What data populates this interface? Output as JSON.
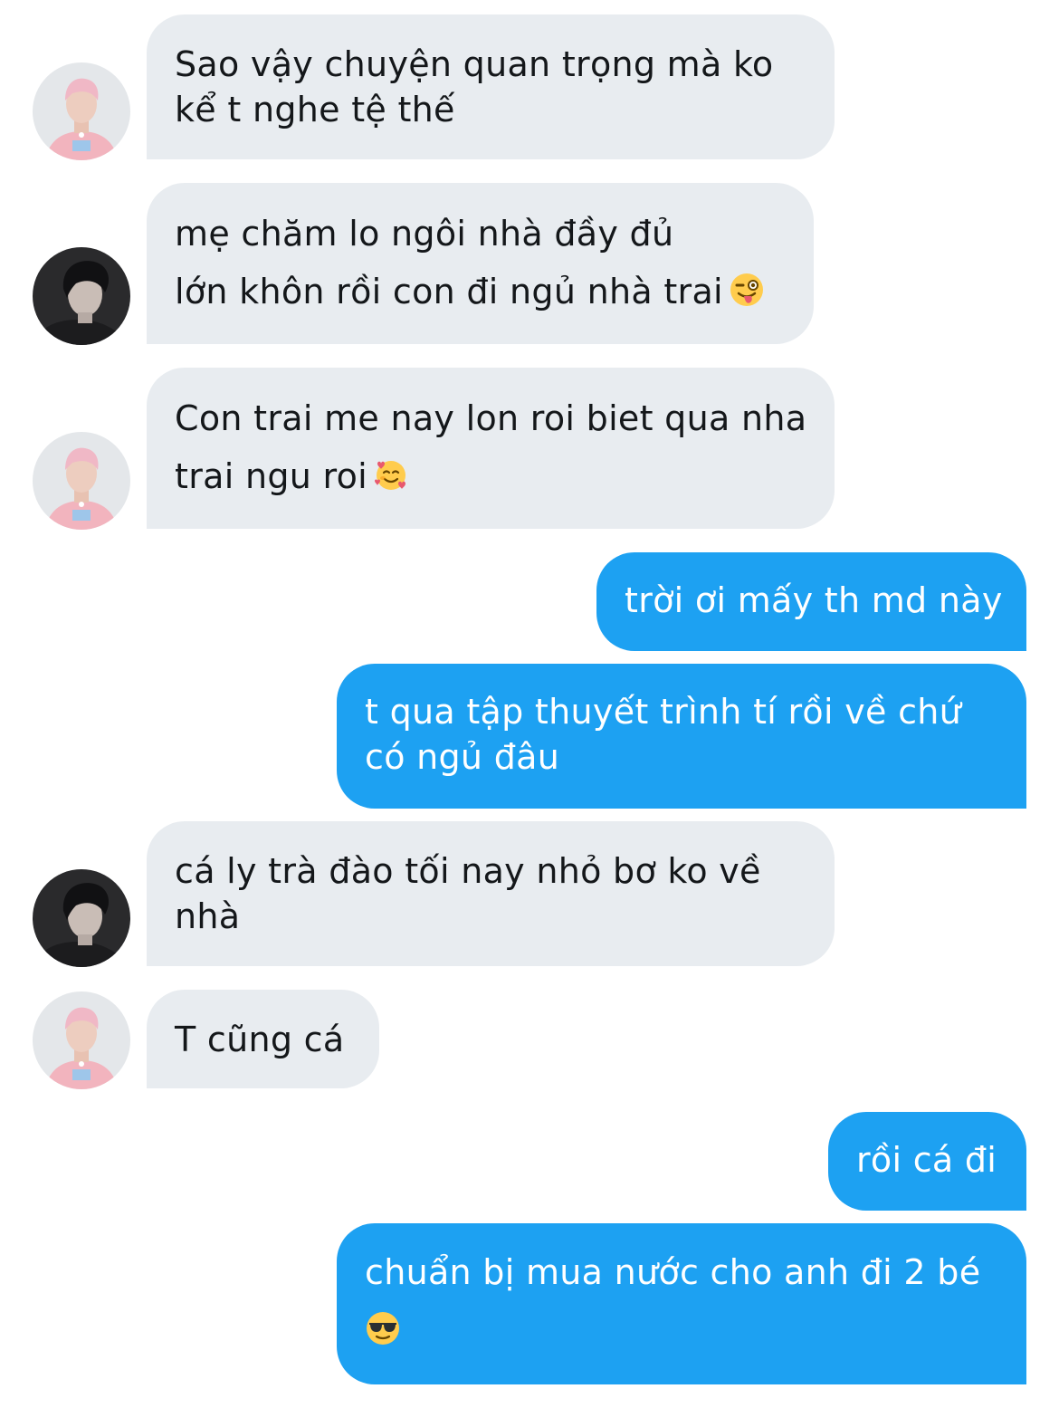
{
  "messages": [
    {
      "side": "incoming",
      "sender_avatar": "pink-hair-avatar",
      "lines": [
        "Sao vậy chuyện quan trọng mà ko",
        "kể t nghe tệ thế"
      ]
    },
    {
      "side": "incoming",
      "sender_avatar": "dark-hair-avatar",
      "lines": [
        "mẹ chăm lo ngôi nhà đầy đủ",
        "lớn khôn rồi con đi ngủ nhà trai"
      ],
      "emoji": "winking-face-with-tongue-icon"
    },
    {
      "side": "incoming",
      "sender_avatar": "pink-hair-avatar",
      "lines": [
        "Con trai me nay lon roi biet qua nha",
        "trai ngu roi"
      ],
      "emoji": "smiling-face-with-hearts-icon"
    },
    {
      "side": "outgoing",
      "lines": [
        "trời ơi mấy th md này"
      ]
    },
    {
      "side": "outgoing",
      "lines": [
        "t qua tập thuyết trình tí rồi về chứ",
        "có ngủ đâu"
      ]
    },
    {
      "side": "incoming",
      "sender_avatar": "dark-hair-avatar",
      "lines": [
        "cá ly trà đào tối nay nhỏ bơ ko về",
        "nhà"
      ]
    },
    {
      "side": "incoming",
      "sender_avatar": "pink-hair-avatar",
      "lines": [
        "T cũng cá"
      ]
    },
    {
      "side": "outgoing",
      "lines": [
        "rồi cá đi"
      ]
    },
    {
      "side": "outgoing",
      "lines": [
        "chuẩn bị mua nước cho anh đi 2 bé"
      ],
      "emoji": "smiling-face-with-sunglasses-icon"
    }
  ],
  "colors": {
    "incoming_bubble": "#e8ecf0",
    "outgoing_bubble": "#1da1f2",
    "incoming_text": "#14171a",
    "outgoing_text": "#ffffff"
  }
}
